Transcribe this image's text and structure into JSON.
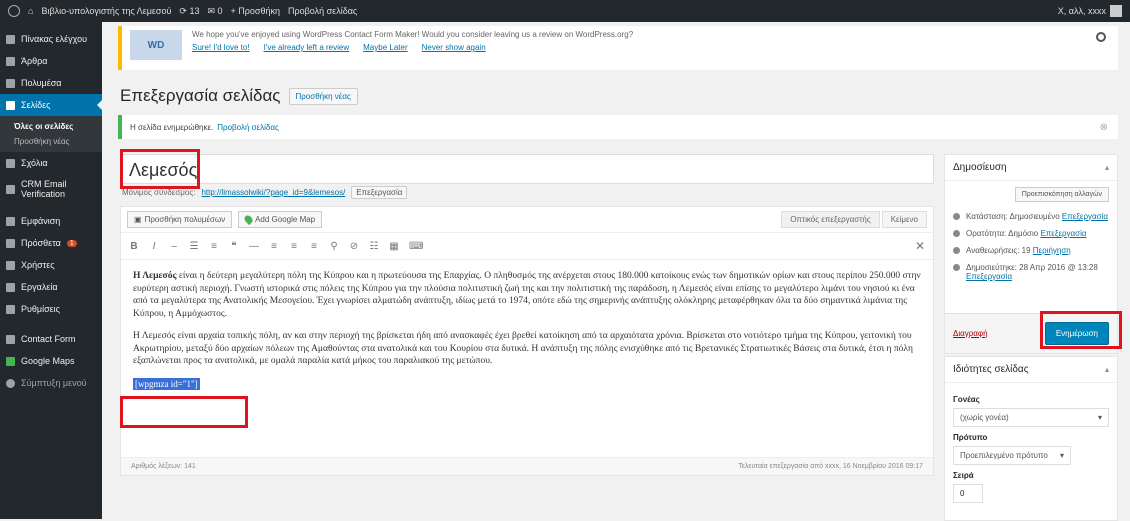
{
  "adminbar": {
    "site_name": "Βιβλιο-υπολογιστής της Λεμεσού",
    "updates": "13",
    "comments": "0",
    "new_label": "Προσθήκη",
    "view_page": "Προβολή σελίδας",
    "greeting": "Χ, αλλ, xxxx"
  },
  "sidebar": {
    "items": [
      {
        "label": "Πίνακας ελέγχου"
      },
      {
        "label": "Άρθρα"
      },
      {
        "label": "Πολυμέσα"
      },
      {
        "label": "Σελίδες"
      },
      {
        "label": "Σχόλια"
      },
      {
        "label": "CRM Email Verification"
      },
      {
        "label": "Εμφάνιση"
      },
      {
        "label": "Πρόσθετα"
      },
      {
        "label": "Χρήστες"
      },
      {
        "label": "Εργαλεία"
      },
      {
        "label": "Ρυθμίσεις"
      },
      {
        "label": "Contact Form"
      },
      {
        "label": "Google Maps"
      },
      {
        "label": "Σύμπτυξη μενού"
      }
    ],
    "submenu": [
      "Όλες οι σελίδες",
      "Προσθήκη νέας"
    ],
    "plugins_badge": "1"
  },
  "review_notice": {
    "text": "We hope you've enjoyed using WordPress Contact Form Maker! Would you consider leaving us a review on WordPress.org?",
    "links": [
      "Sure! I'd love to!",
      "I've already left a review",
      "Maybe Later",
      "Never show again"
    ],
    "logo": "WD"
  },
  "page": {
    "heading": "Επεξεργασία σελίδας",
    "add_new": "Προσθήκη νέας",
    "updated_msg": "Η σελίδα ενημερώθηκε.",
    "updated_link": "Προβολή σελίδας",
    "title": "Λεμεσός",
    "permalink_label": "Μόνιμος σύνδεσμος:",
    "permalink_url": "http://limassolwiki/?page_id=9&lemesos/",
    "permalink_edit": "Επεξεργασία"
  },
  "editor": {
    "add_media": "Προσθήκη πολυμέσων",
    "add_map": "Add Google Map",
    "tab_visual": "Οπτικός επεξεργαστής",
    "tab_text": "Κείμενο",
    "para1_bold": "Η Λεμεσός",
    "para1": " είναι η δεύτερη μεγαλύτερη πόλη της Κύπρου και η πρωτεύουσα της Επαρχίας. Ο πληθυσμός της ανέρχεται στους 180.000 κατοίκους ενώς των δημοτικών ορίων και στους περίπου 250.000 στην ευρύτερη αστική περιοχή. Γνωστή ιστορικά στις πόλεις της Κύπρου για την πλούσια πολιτιστική ζωή της και την πολιτιστική της παράδοση, η Λεμεσός είναι επίσης το μεγαλύτερο λιμάνι του νησιού κι ένα από τα μεγαλύτερα της Ανατολικής Μεσογείου. Έχει γνωρίσει αλματώδη ανάπτυξη, ιδίως μετά το 1974, οπότε εδώ της σημερινής ανάπτυξης ολόκληρης μεταφέρθηκαν όλα τα δύο σημαντικά λιμάνια της Κύπρου, η Αμμόχωστος.",
    "para2": "Η Λεμεσός είναι αρχαία τοπικής πόλη, αν και στην περιοχή της βρίσκεται ήδη από ανασκαφές έχει βρεθεί κατοίκηση από τα αρχαιότατα χρόνια. Βρίσκεται στο νοτιότερο τμήμα της Κύπρου, γειτονική του Ακρωτηρίου, μεταξύ δύο αρχαίων πόλεων της Αμαθούντας στα ανατολικά και του Κουρίου στα δυτικά. Η ανάπτυξη της πόλης ενισχύθηκε από τις Βρετανικές Στρατιωτικές Βάσεις στα δυτικά, έτσι η πόλη εξαπλώνεται προς τα ανατολικά, με ομαλά παραλία κατά μήκος του παραλιακού της μετώπου.",
    "shortcode": "[wpgmza id=\"1\"]",
    "word_count": "Αριθμός λέξεων: 141",
    "last_edit": "Τελευταία επεξεργασία από xxxx, 16 Νοεμβρίου 2016 09:17"
  },
  "publish": {
    "title": "Δημοσίευση",
    "preview": "Προεπισκόπηση αλλαγών",
    "status": "Κατάσταση: Δημοσιευμένο",
    "status_edit": "Επεξεργασία",
    "visibility": "Ορατότητα: Δημόσιο",
    "visibility_edit": "Επεξεργασία",
    "revisions": "Αναθεωρήσεις: 19",
    "revisions_link": "Περιήγηση",
    "published": "Δημοσιεύτηκε: 28 Απρ 2016 @ 13:28",
    "published_edit": "Επεξεργασία",
    "trash": "Διαγραφή",
    "update": "Ενημέρωση"
  },
  "attributes": {
    "title": "Ιδιότητες σελίδας",
    "parent_label": "Γονέας",
    "parent_value": "(χωρίς γονέα)",
    "template_label": "Πρότυπο",
    "template_value": "Προεπιλεγμένο πρότυπο",
    "order_label": "Σειρά",
    "order_value": "0"
  }
}
